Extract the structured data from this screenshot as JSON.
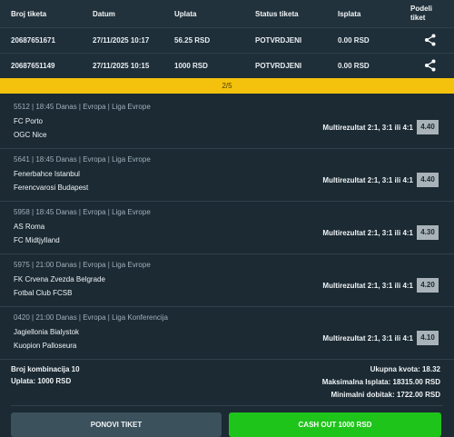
{
  "header": {
    "col_ticket": "Broj tiketa",
    "col_date": "Datum",
    "col_payment": "Uplata",
    "col_status": "Status tiketa",
    "col_payout": "Isplata",
    "col_share": "Podeli\ntiket"
  },
  "tickets": [
    {
      "number": "20687651671",
      "date": "27/11/2025 10:17",
      "payment": "56.25 RSD",
      "status": "POTVRDJENI",
      "payout": "0.00 RSD"
    },
    {
      "number": "20687651149",
      "date": "27/11/2025 10:15",
      "payment": "1000 RSD",
      "status": "POTVRDJENI",
      "payout": "0.00 RSD"
    }
  ],
  "pager": "2/5",
  "matches": [
    {
      "meta": "5512 | 18:45 Danas | Evropa | Liga Evrope",
      "home": "FC Porto",
      "away": "OGC Nice",
      "pick": "Multirezultat 2:1, 3:1 ili 4:1",
      "odds": "4.40"
    },
    {
      "meta": "5641 | 18:45 Danas | Evropa | Liga Evrope",
      "home": "Fenerbahce Istanbul",
      "away": "Ferencvarosi Budapest",
      "pick": "Multirezultat 2:1, 3:1 ili 4:1",
      "odds": "4.40"
    },
    {
      "meta": "5958 | 18:45 Danas | Evropa | Liga Evrope",
      "home": "AS Roma",
      "away": "FC Midtjylland",
      "pick": "Multirezultat 2:1, 3:1 ili 4:1",
      "odds": "4.30"
    },
    {
      "meta": "5975 | 21:00 Danas | Evropa | Liga Evrope",
      "home": "FK Crvena Zvezda Belgrade",
      "away": "Fotbal Club FCSB",
      "pick": "Multirezultat 2:1, 3:1 ili 4:1",
      "odds": "4.20"
    },
    {
      "meta": "0420 | 21:00 Danas | Evropa | Liga Konferencija",
      "home": "Jagiellonia Bialystok",
      "away": "Kuopion Palloseura",
      "pick": "Multirezultat 2:1, 3:1 ili 4:1",
      "odds": "4.10"
    }
  ],
  "summary": {
    "combinations": "Broj kombinacija 10",
    "stake": "Uplata: 1000 RSD",
    "total_odds": "Ukupna kvota: 18.32",
    "max_payout": "Maksimalna Isplata: 18315.00 RSD",
    "min_win": "Minimalni dobitak: 1722.00 RSD"
  },
  "buttons": {
    "retry": "PONOVI TIKET",
    "cashout": "CASH OUT 1000 RSD"
  },
  "icons": {
    "share": "share-icon"
  },
  "colors": {
    "pager": "#f4c20d",
    "cashout": "#1fc41a",
    "odds_badge": "#a8b2b8"
  }
}
